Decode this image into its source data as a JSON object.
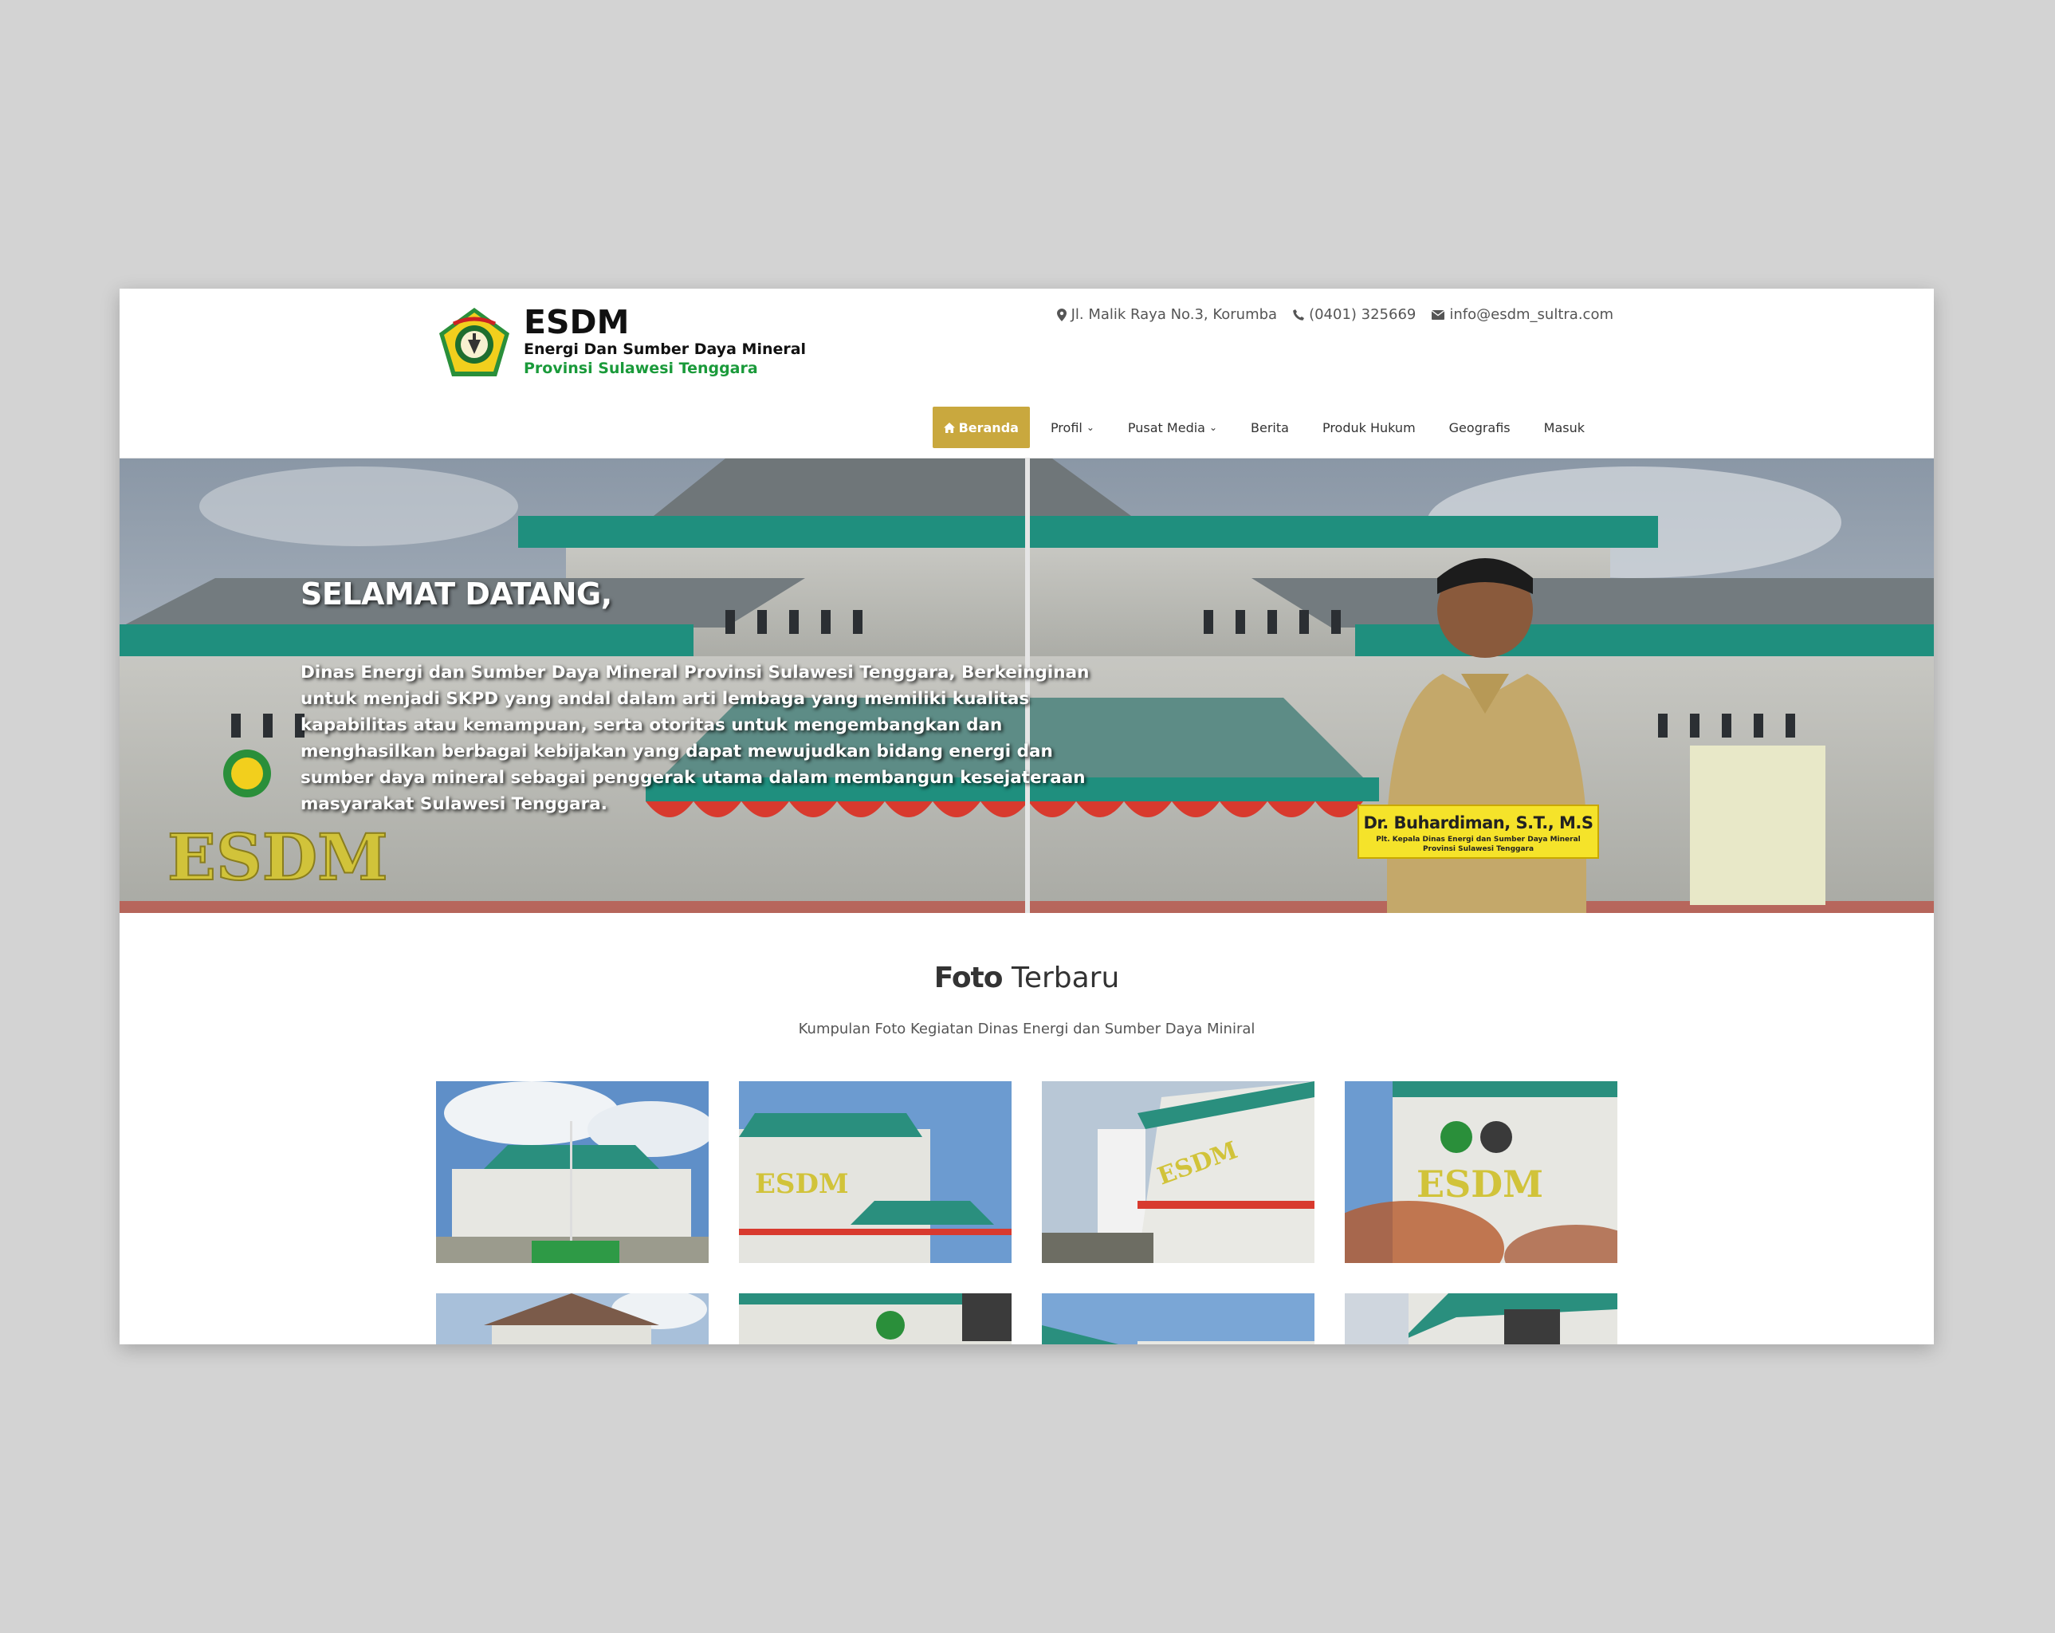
{
  "header": {
    "logo_title": "ESDM",
    "logo_subtitle": "Energi Dan Sumber Daya Mineral",
    "logo_province": "Provinsi Sulawesi Tenggara",
    "address": "Jl. Malik Raya No.3, Korumba",
    "phone": "(0401) 325669",
    "email": "info@esdm_sultra.com"
  },
  "nav": {
    "home": "Beranda",
    "profile": "Profil",
    "media": "Pusat Media",
    "news": "Berita",
    "law": "Produk Hukum",
    "geo": "Geografis",
    "login": "Masuk"
  },
  "hero": {
    "title": "SELAMAT DATANG,",
    "text": "Dinas Energi dan Sumber Daya Mineral Provinsi Sulawesi Tenggara, Berkeinginan untuk menjadi SKPD yang andal dalam arti lembaga yang memiliki kualitas kapabilitas atau kemampuan, serta otoritas untuk mengembangkan dan menghasilkan berbagai kebijakan yang dapat mewujudkan bidang energi dan sumber daya mineral sebagai penggerak utama dalam membangun kesejateraan masyarakat Sulawesi Tenggara.",
    "building_sign": "ESDM",
    "person_name": "Dr. Buhardiman, S.T., M.S",
    "person_role_line1": "Plt. Kepala Dinas Energi dan Sumber Daya Mineral",
    "person_role_line2": "Provinsi Sulawesi Tenggara"
  },
  "gallery": {
    "title_bold": "Foto",
    "title_rest": " Terbaru",
    "subtitle": "Kumpulan Foto Kegiatan Dinas Energi dan Sumber Daya Miniral"
  },
  "colors": {
    "accent": "#c9a83e",
    "green": "#1a9a3a",
    "roof_teal": "#1f8f7e"
  }
}
